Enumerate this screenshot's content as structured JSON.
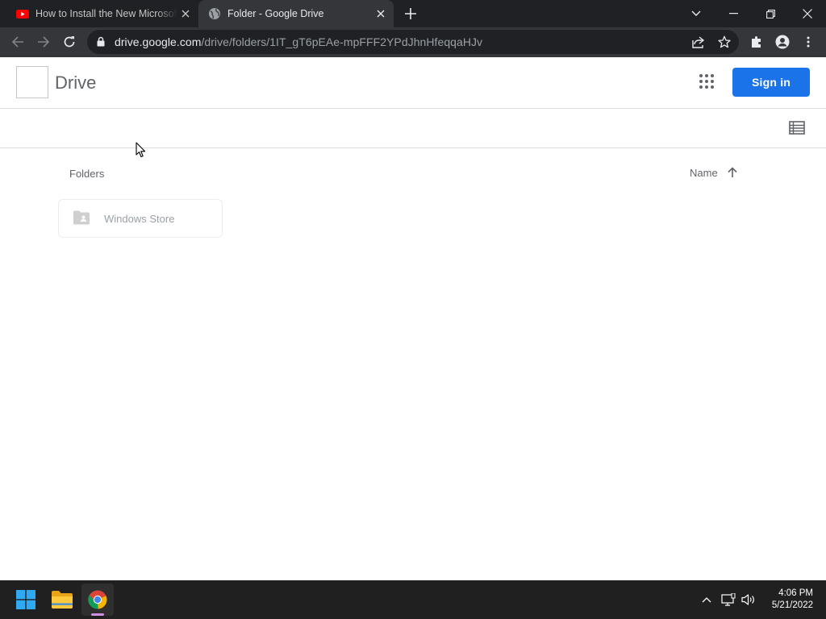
{
  "browser": {
    "tabs": [
      {
        "title": "How to Install the New Microsoft Store",
        "favicon": "youtube-icon",
        "active": false
      },
      {
        "title": "Folder - Google Drive",
        "favicon": "globe-icon",
        "active": true
      }
    ],
    "url_host": "drive.google.com",
    "url_path": "/drive/folders/1IT_gT6pEAe-mpFFF2YPdJhnHfeqqaHJv"
  },
  "drive": {
    "app_title": "Drive",
    "sign_in_label": "Sign in",
    "folders_label": "Folders",
    "sort_label": "Name",
    "folders": [
      {
        "name": "Windows Store",
        "icon": "shared-folder-icon"
      }
    ],
    "accent_color": "#1a73e8"
  },
  "taskbar": {
    "apps": [
      "start-icon",
      "file-explorer-icon",
      "chrome-icon"
    ],
    "time": "4:06 PM",
    "date": "5/21/2022"
  }
}
